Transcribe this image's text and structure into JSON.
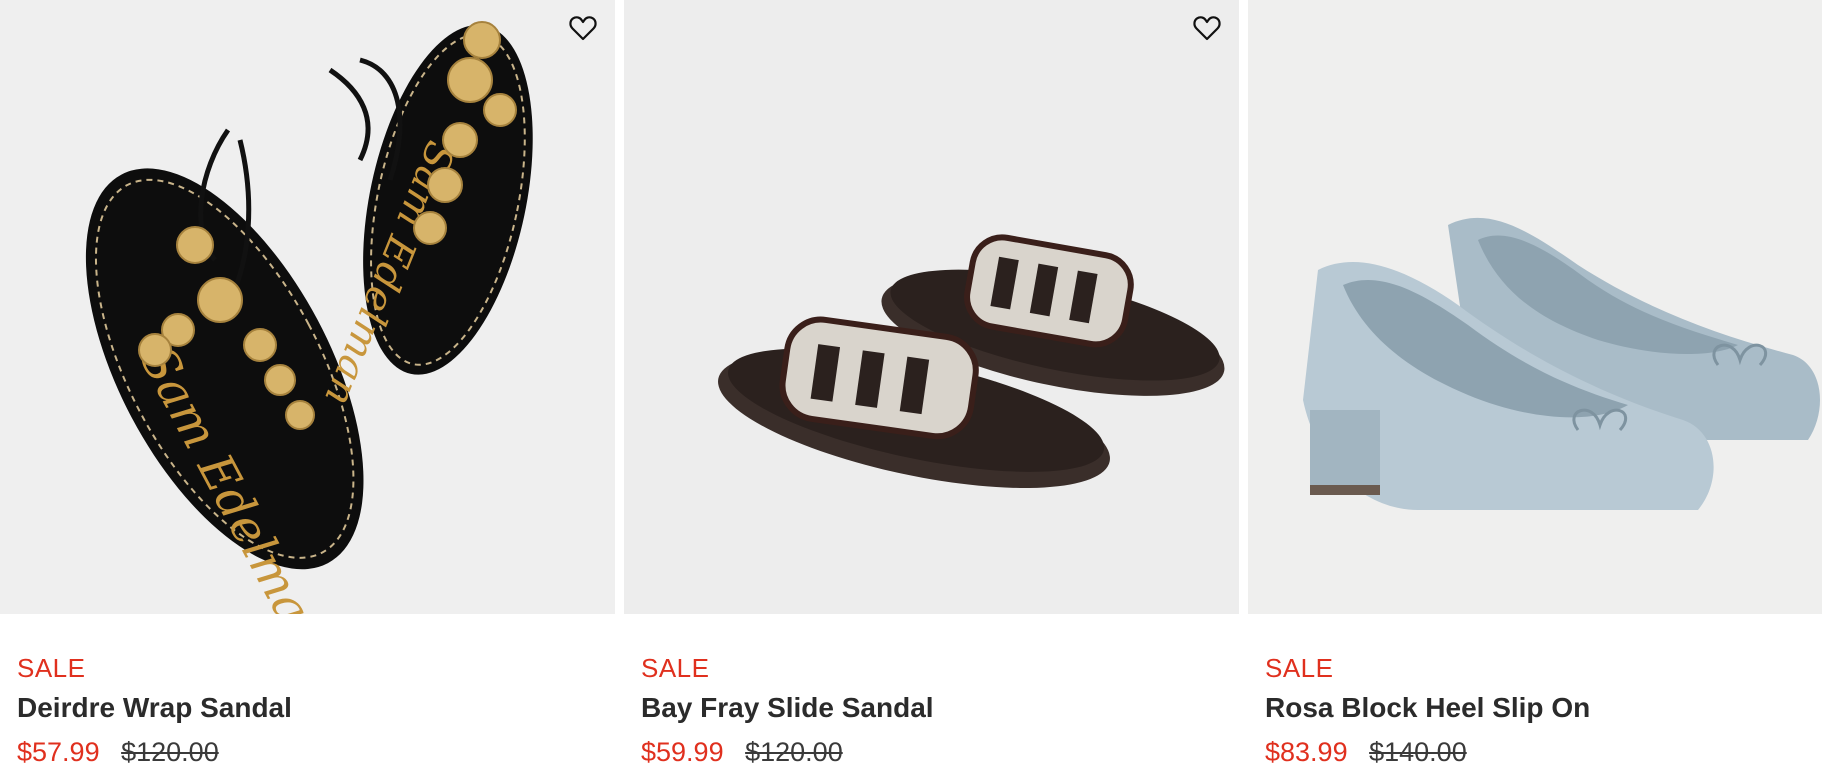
{
  "products": [
    {
      "badge": "SALE",
      "name": "Deirdre Wrap Sandal",
      "sale_price": "$57.99",
      "original_price": "$120.00",
      "image_icon": "product-image-wrap-sandal",
      "wishlist_icon": "heart-outline-icon"
    },
    {
      "badge": "SALE",
      "name": "Bay Fray Slide Sandal",
      "sale_price": "$59.99",
      "original_price": "$120.00",
      "image_icon": "product-image-slide-sandal",
      "wishlist_icon": "heart-outline-icon"
    },
    {
      "badge": "SALE",
      "name": "Rosa Block Heel Slip On",
      "sale_price": "$83.99",
      "original_price": "$140.00",
      "image_icon": "product-image-block-heel",
      "wishlist_icon": null
    }
  ],
  "colors": {
    "sale_red": "#e0301e",
    "text_dark": "#2b2b2b",
    "image_bg": "#efefef"
  }
}
